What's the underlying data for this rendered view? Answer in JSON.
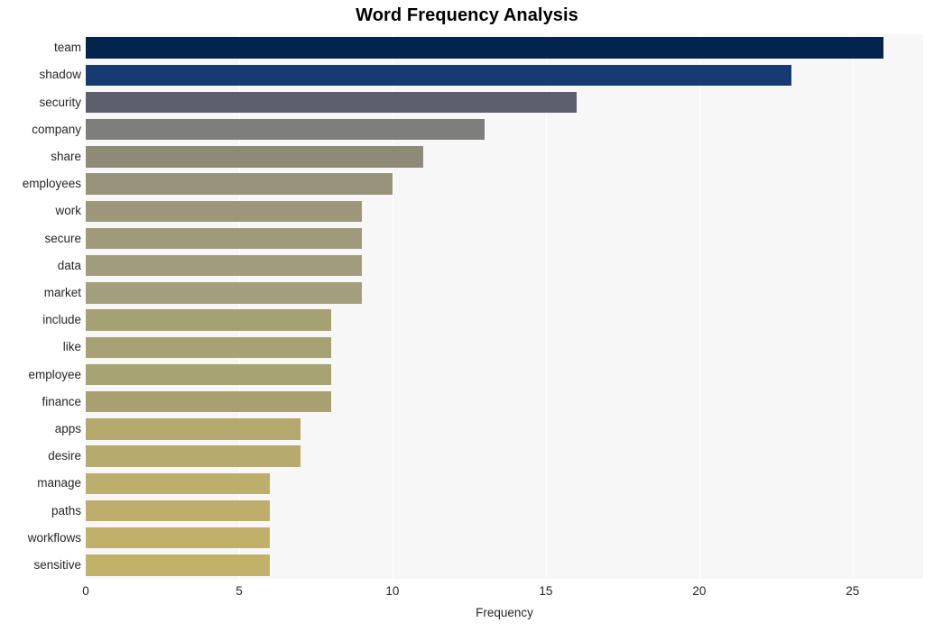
{
  "chart_data": {
    "type": "bar",
    "orientation": "horizontal",
    "title": "Word Frequency Analysis",
    "xlabel": "Frequency",
    "ylabel": "",
    "categories": [
      "team",
      "shadow",
      "security",
      "company",
      "share",
      "employees",
      "work",
      "secure",
      "data",
      "market",
      "include",
      "like",
      "employee",
      "finance",
      "apps",
      "desire",
      "manage",
      "paths",
      "workflows",
      "sensitive"
    ],
    "values": [
      26,
      23,
      16,
      13,
      11,
      10,
      9,
      9,
      9,
      9,
      8,
      8,
      8,
      8,
      7,
      7,
      6,
      6,
      6,
      6
    ],
    "bar_colors": [
      "#03244d",
      "#173a73",
      "#5e5f6e",
      "#7e7e7c",
      "#8d8b78",
      "#979379",
      "#9c9779",
      "#9e9a7a",
      "#a19c7b",
      "#a39e7c",
      "#a6a173",
      "#a7a273",
      "#a8a372",
      "#a9a072",
      "#b4a86e",
      "#b6aa6d",
      "#bcae6c",
      "#bfae6b",
      "#c1b06a",
      "#c2b169"
    ],
    "xlim": [
      0,
      27.3
    ],
    "xticks": [
      0,
      5,
      10,
      15,
      20,
      25
    ],
    "xtick_labels": [
      "0",
      "5",
      "10",
      "15",
      "20",
      "25"
    ],
    "grid": "vertical",
    "legend": "none",
    "plot_background": "#f7f7f7",
    "gridline_color": "#ffffff",
    "figure_background": "#ffffff"
  }
}
